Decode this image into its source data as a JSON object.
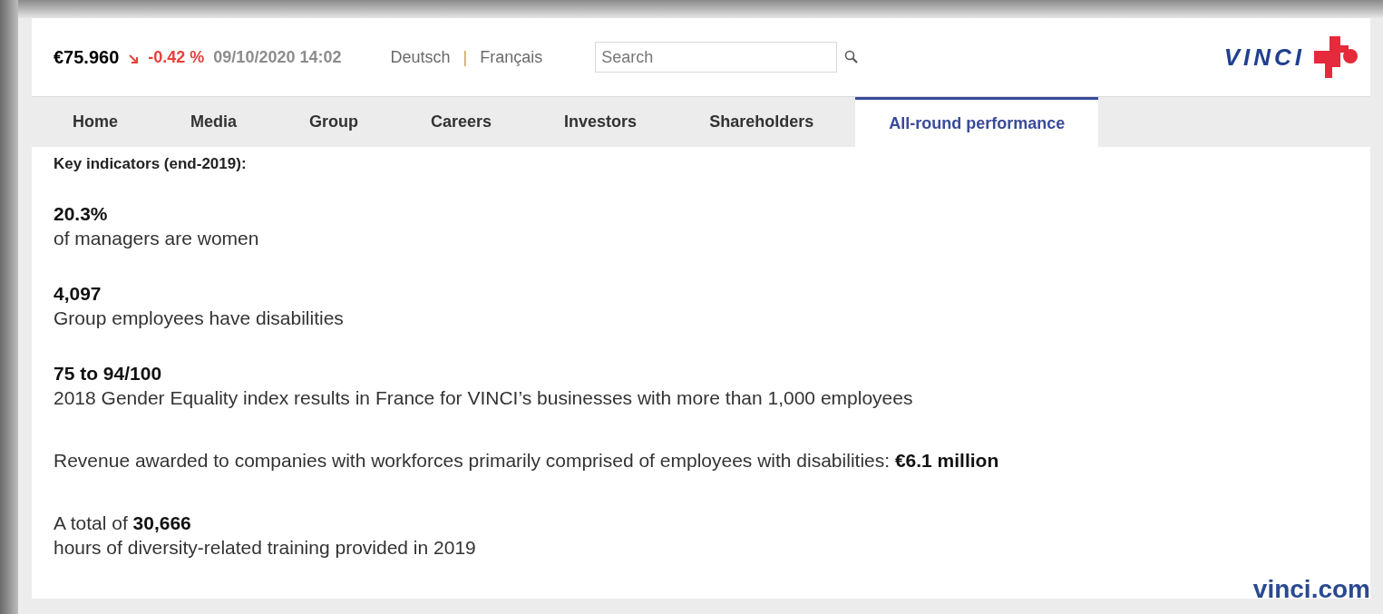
{
  "header": {
    "share_price": "€75.960",
    "price_falling": true,
    "change": "-0.42 %",
    "timestamp": "09/10/2020 14:02",
    "languages": [
      "Deutsch",
      "Français"
    ],
    "language_separator": "|",
    "search": {
      "placeholder": "Search"
    },
    "logo_text": "VINCI"
  },
  "nav": [
    {
      "label": "Home",
      "selected": false
    },
    {
      "label": "Media",
      "selected": false
    },
    {
      "label": "Group",
      "selected": false
    },
    {
      "label": "Careers",
      "selected": false
    },
    {
      "label": "Investors",
      "selected": false
    },
    {
      "label": "Shareholders",
      "selected": false
    },
    {
      "label": "All-round performance",
      "selected": true
    }
  ],
  "content": {
    "heading": "Key indicators (end-2019):",
    "items": [
      {
        "kind": "stat",
        "value": "20.3%",
        "caption": "of managers are women"
      },
      {
        "kind": "stat",
        "value": "4,097",
        "caption": "Group employees have disabilities"
      },
      {
        "kind": "stat",
        "value": "75 to 94/100",
        "caption": "2018 Gender Equality index results in France for VINCI’s businesses with more than 1,000 employees"
      },
      {
        "kind": "sentence",
        "text": "Revenue awarded to companies with workforces primarily comprised of employees with disabilities: **€6.1 million**"
      },
      {
        "kind": "sentence",
        "text": "A total of **30,666**",
        "caption": "hours of diversity-related training provided in 2019"
      }
    ]
  },
  "source_caption": "vinci.com"
}
